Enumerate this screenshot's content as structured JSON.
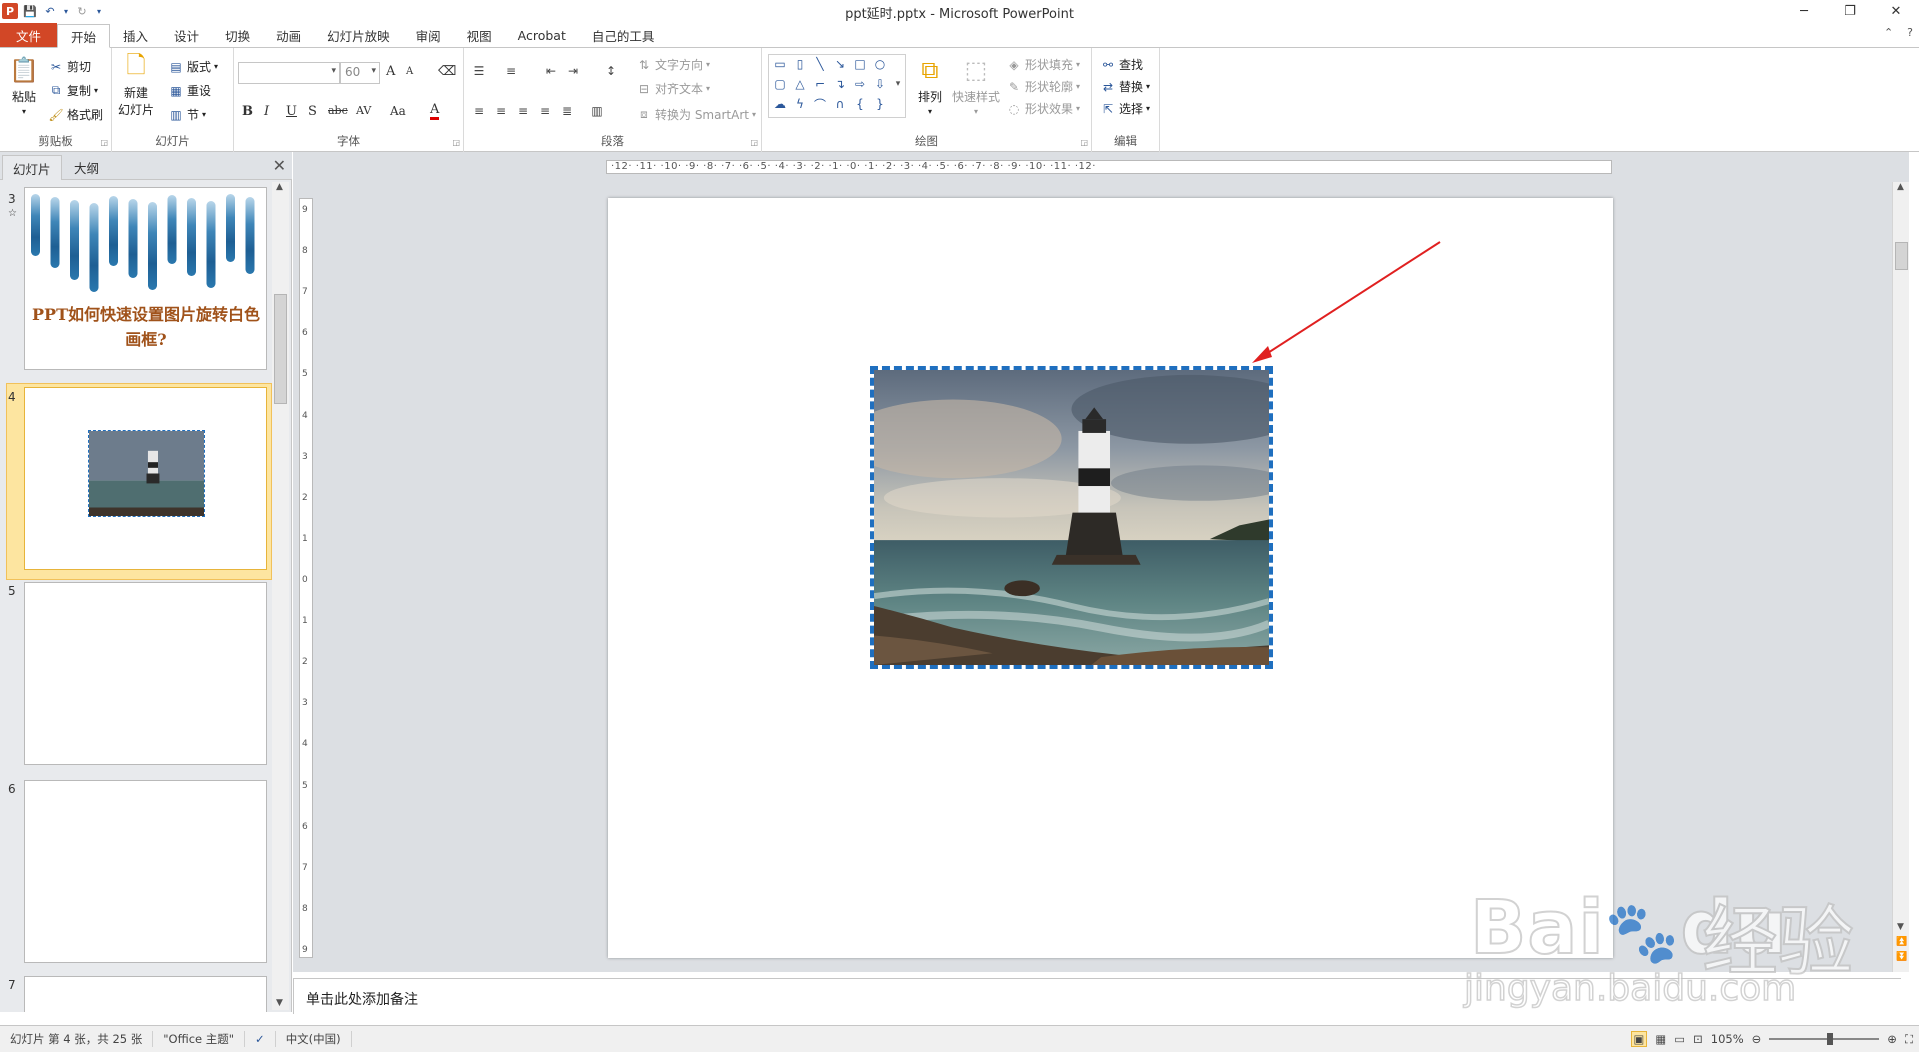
{
  "window": {
    "title": "ppt延时.pptx - Microsoft PowerPoint",
    "app_logo": "P",
    "controls": {
      "minimize": "─",
      "restore": "❐",
      "close": "✕"
    }
  },
  "tabs": [
    "文件",
    "开始",
    "插入",
    "设计",
    "切换",
    "动画",
    "幻灯片放映",
    "审阅",
    "视图",
    "Acrobat",
    "自己的工具"
  ],
  "ribbon": {
    "clipboard": {
      "paste": "粘贴",
      "cut": "剪切",
      "copy": "复制",
      "format_painter": "格式刷",
      "label": "剪贴板"
    },
    "slides": {
      "new_slide_1": "新建",
      "new_slide_2": "幻灯片",
      "layout": "版式",
      "reset": "重设",
      "section": "节",
      "label": "幻灯片"
    },
    "font": {
      "font_size": "60",
      "label": "字体",
      "bold": "B",
      "italic": "I",
      "underline": "U",
      "shadow": "S",
      "strike": "abc",
      "spacing": "AV",
      "case": "Aa",
      "color": "A",
      "grow": "A",
      "shrink": "A"
    },
    "paragraph": {
      "text_direction": "文字方向",
      "align_text": "对齐文本",
      "smartart": "转换为 SmartArt",
      "label": "段落"
    },
    "drawing": {
      "arrange": "排列",
      "quick_styles": "快速样式",
      "shape_fill": "形状填充",
      "shape_outline": "形状轮廓",
      "shape_effects": "形状效果",
      "label": "绘图"
    },
    "editing": {
      "find": "查找",
      "replace": "替换",
      "select": "选择",
      "label": "编辑"
    }
  },
  "left_pane": {
    "tab_slides": "幻灯片",
    "tab_outline": "大纲",
    "close": "✕",
    "slide3_number": "3",
    "slide3_title": "PPT如何快速设置图片旋转白色画框?",
    "slide4_number": "4",
    "slide5_number": "5",
    "slide6_number": "6",
    "slide7_number": "7"
  },
  "ruler": {
    "horizontal": "·12·  ·11·  ·10·  ·9·  ·8·  ·7·  ·6·  ·5·  ·4·  ·3·  ·2·  ·1·  ·0·  ·1·  ·2·  ·3·  ·4·  ·5·  ·6·  ·7·  ·8·  ·9·  ·10·  ·11·  ·12·",
    "vertical": [
      "9",
      "8",
      "7",
      "6",
      "5",
      "4",
      "3",
      "2",
      "1",
      "0",
      "1",
      "2",
      "3",
      "4",
      "5",
      "6",
      "7",
      "8",
      "9"
    ]
  },
  "notes": {
    "placeholder": "单击此处添加备注"
  },
  "status": {
    "slide_info": "幻灯片 第 4 张，共 25 张",
    "theme": "\"Office 主题\"",
    "language": "中文(中国)",
    "zoom": "105%"
  },
  "watermark": {
    "brand": "Bai",
    "brand2": "du",
    "cn": "经验",
    "url": "jingyan.baidu.com"
  },
  "colors": {
    "accent": "#d24726",
    "selection_border": "#1f6fbf",
    "arrow": "#e02020"
  }
}
